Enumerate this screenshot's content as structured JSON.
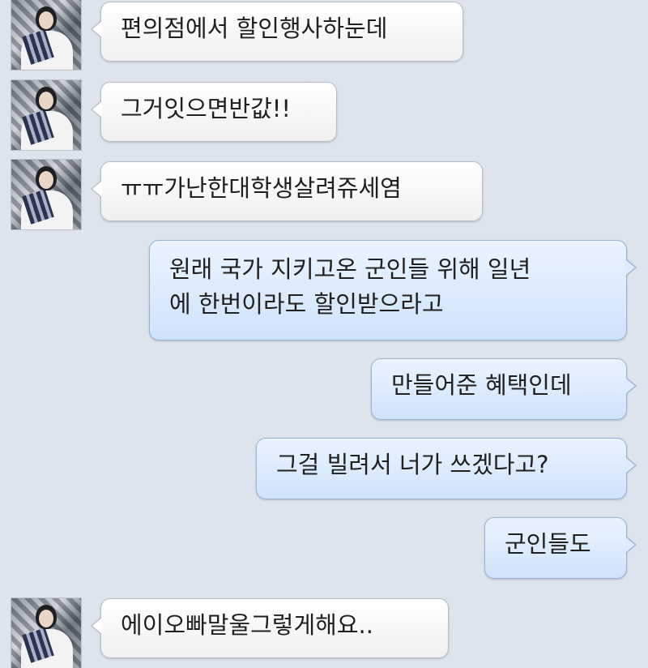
{
  "chat": {
    "incoming": [
      {
        "text": "편의점에서 할인행사하눈데"
      },
      {
        "text": "그거잇으면반값!!"
      },
      {
        "text": "ㅠㅠ가난한대학생살려쥬세염"
      },
      {
        "text": "에이오빠말울그렇게해요.."
      }
    ],
    "outgoing": [
      {
        "lines": [
          "원래 국가 지키고온 군인들 위해 일년",
          "에 한번이라도 할인받으라고"
        ]
      },
      {
        "text": "만들어준 혜택인데"
      },
      {
        "text": "그걸 빌려서 너가 쓰겠다고?"
      },
      {
        "text": "군인들도"
      }
    ]
  }
}
